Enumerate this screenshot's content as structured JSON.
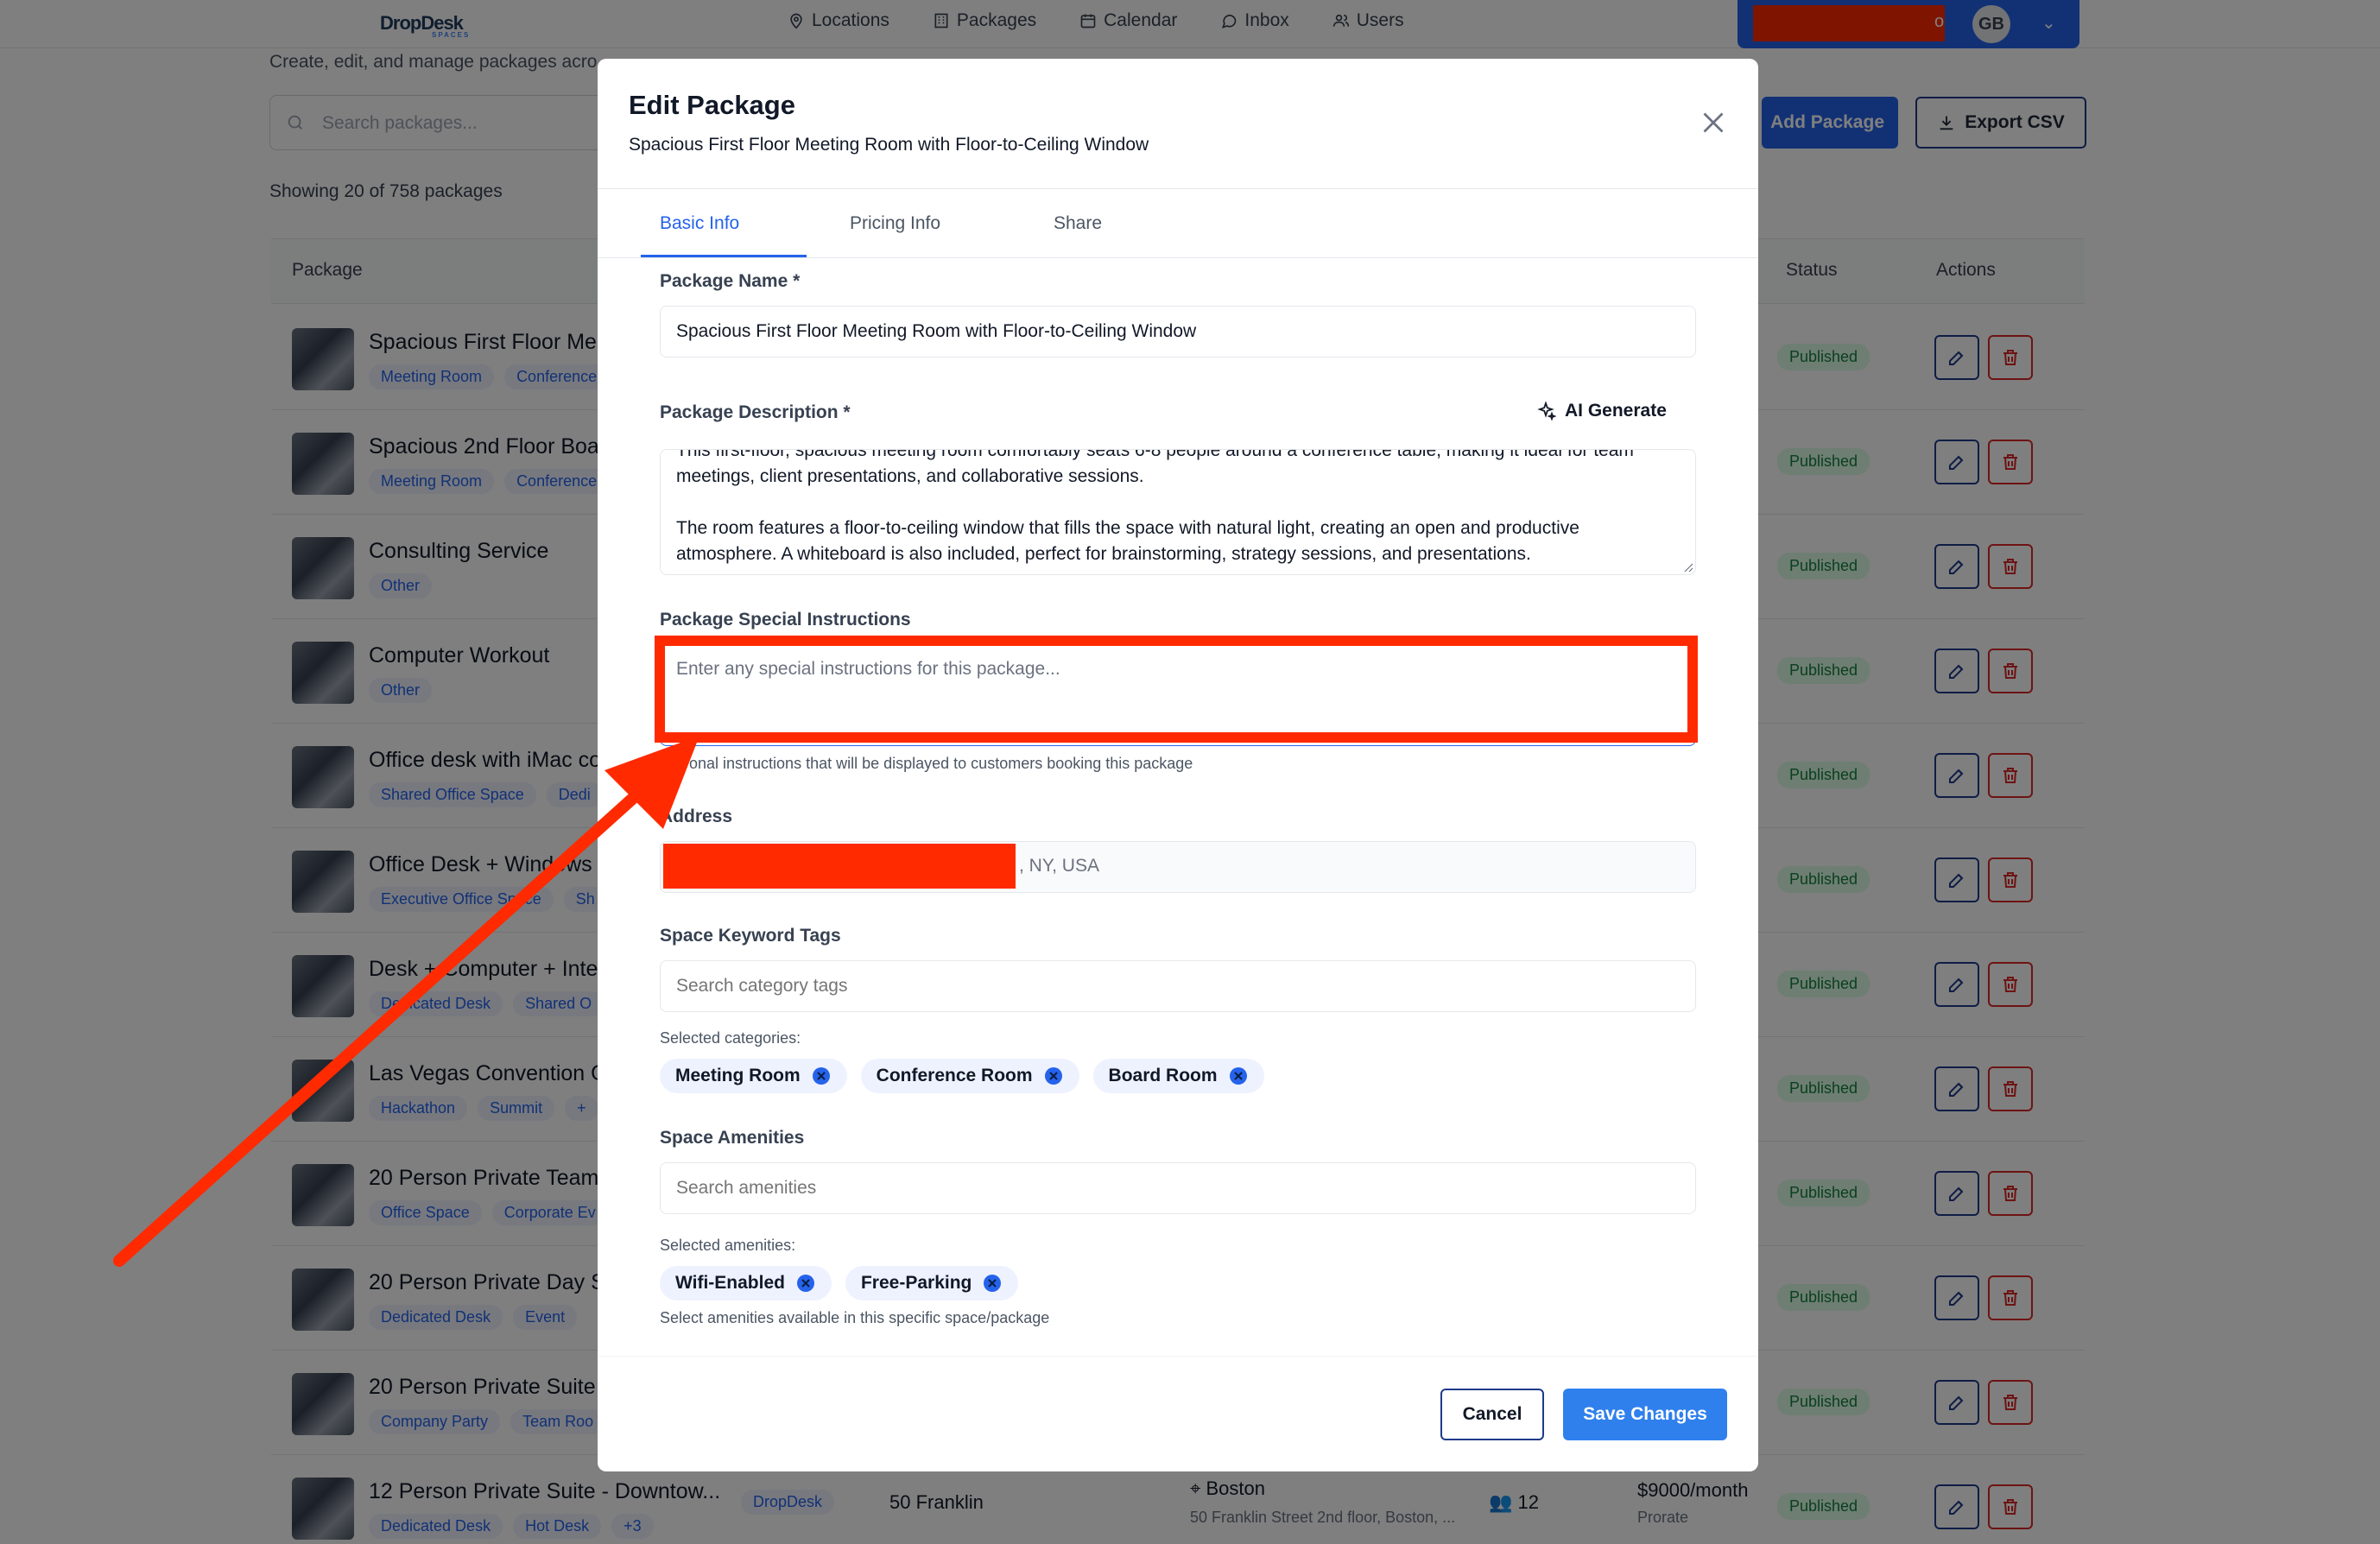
{
  "topbar": {
    "logo": "DropDesk",
    "logo_sub": "SPACES",
    "nav": [
      {
        "label": "Locations",
        "icon": "map-pin-icon"
      },
      {
        "label": "Packages",
        "icon": "building-icon"
      },
      {
        "label": "Calendar",
        "icon": "calendar-icon"
      },
      {
        "label": "Inbox",
        "icon": "chat-bubble-icon"
      },
      {
        "label": "Users",
        "icon": "users-icon"
      }
    ],
    "user_suffix": "o",
    "avatar_initials": "GB"
  },
  "page": {
    "subtitle": "Create, edit, and manage packages acro",
    "search_placeholder": "Search packages...",
    "add_button": "Add Package",
    "export_button": "Export CSV",
    "showing": "Showing 20 of 758 packages",
    "columns": {
      "package": "Package",
      "status": "Status",
      "actions": "Actions"
    }
  },
  "rows": [
    {
      "name": "Spacious First Floor Mee",
      "tags": [
        "Meeting Room",
        "Conference"
      ],
      "status": "Published"
    },
    {
      "name": "Spacious 2nd Floor Boar",
      "tags": [
        "Meeting Room",
        "Conference"
      ],
      "status": "Published"
    },
    {
      "name": "Consulting Service",
      "tags": [
        "Other"
      ],
      "status": "Published"
    },
    {
      "name": "Computer Workout",
      "tags": [
        "Other"
      ],
      "status": "Published"
    },
    {
      "name": "Office desk with iMac cor",
      "tags": [
        "Shared Office Space",
        "Dedi"
      ],
      "status": "Published"
    },
    {
      "name": "Office Desk + Windows C",
      "tags": [
        "Executive Office Space",
        "Sh"
      ],
      "status": "Published"
    },
    {
      "name": "Desk + Computer + Inter",
      "tags": [
        "Dedicated Desk",
        "Shared O"
      ],
      "status": "Published"
    },
    {
      "name": "Las Vegas Convention O",
      "tags": [
        "Hackathon",
        "Summit",
        "+"
      ],
      "status": "Published"
    },
    {
      "name": "20 Person Private Team",
      "tags": [
        "Office Space",
        "Corporate Ev"
      ],
      "status": "Published"
    },
    {
      "name": "20 Person Private Day S",
      "tags": [
        "Dedicated Desk",
        "Event"
      ],
      "status": "Published"
    },
    {
      "name": "20 Person Private Suite -",
      "tags": [
        "Company Party",
        "Team Roo"
      ],
      "status": "Published"
    },
    {
      "name": "12 Person Private Suite - Downtow...",
      "tags": [
        "Dedicated Desk",
        "Hot Desk",
        "+3"
      ],
      "status": "Published",
      "owner": "DropDesk",
      "location": "50 Franklin",
      "city": "Boston",
      "address": "50 Franklin Street 2nd floor, Boston, ...",
      "capacity": "12",
      "price": "$9000/month",
      "price_note": "Prorate"
    }
  ],
  "modal": {
    "title": "Edit Package",
    "subtitle": "Spacious First Floor Meeting Room with Floor-to-Ceiling Window",
    "tabs": [
      "Basic Info",
      "Pricing Info",
      "Share"
    ],
    "active_tab": "Basic Info",
    "package_name_label": "Package Name *",
    "package_name_value": "Spacious First Floor Meeting Room with Floor-to-Ceiling Window",
    "description_label": "Package Description *",
    "ai_generate": "AI Generate",
    "description_paragraphs": [
      "This first-floor, spacious meeting room comfortably seats 6-8 people around a conference table, making it ideal for team meetings, client presentations, and collaborative sessions.",
      "The room features a floor-to-ceiling window that fills the space with natural light, creating an open and productive atmosphere. A whiteboard is also included, perfect for brainstorming, strategy sessions, and presentations."
    ],
    "special_label": "Package Special Instructions",
    "special_placeholder": "Enter any special instructions for this package...",
    "special_helper": "onal instructions that will be displayed to customers booking this package",
    "address_label": "Address",
    "address_suffix": ", NY, USA",
    "keywords_label": "Space Keyword Tags",
    "keywords_placeholder": "Search category tags",
    "selected_categories_label": "Selected categories:",
    "categories": [
      "Meeting Room",
      "Conference Room",
      "Board Room"
    ],
    "amenities_label": "Space Amenities",
    "amenities_placeholder": "Search amenities",
    "selected_amenities_label": "Selected amenities:",
    "amenities": [
      "Wifi-Enabled",
      "Free-Parking"
    ],
    "amenities_helper": "Select amenities available in this specific space/package",
    "cancel": "Cancel",
    "save": "Save Changes"
  },
  "colors": {
    "accent": "#2563eb",
    "annotation": "#ff2a00",
    "published_bg": "#dcfce7",
    "published_text": "#15803d"
  }
}
